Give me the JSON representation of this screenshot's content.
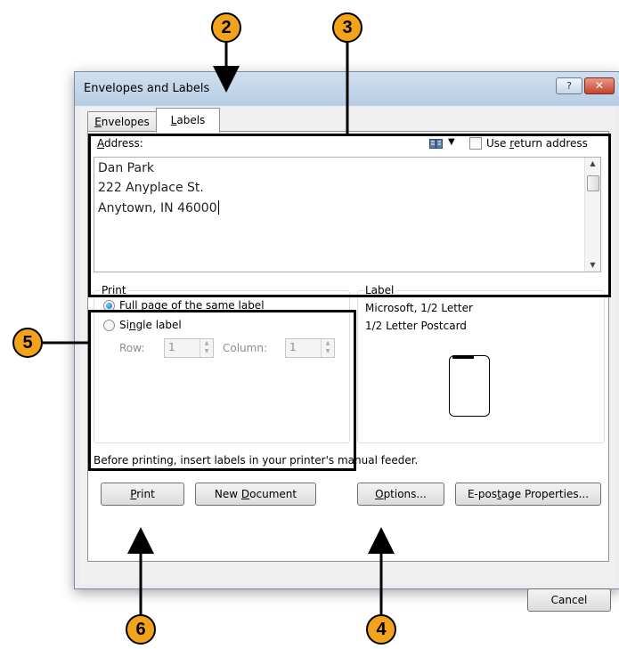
{
  "window": {
    "title": "Envelopes and Labels",
    "help_button": "?",
    "close_button": "✕"
  },
  "tabs": [
    {
      "label": "Envelopes",
      "mnemonic": "E",
      "rest": "nvelopes",
      "active": false
    },
    {
      "label": "Labels",
      "mnemonic": "L",
      "rest": "abels",
      "active": true
    }
  ],
  "address": {
    "label_mnemonic": "A",
    "label_rest": "ddress:",
    "lines": [
      "Dan Park",
      "222 Anyplace St.",
      "Anytown, IN 46000"
    ],
    "use_return": {
      "pre": "Use ",
      "mnemonic": "r",
      "post": "eturn address",
      "checked": false
    }
  },
  "print_group": {
    "title": "Print",
    "full_page": {
      "mnemonic": "F",
      "rest": "ull page of the same label",
      "selected": true
    },
    "single": {
      "pre": "Si",
      "mnemonic": "n",
      "post": "gle label",
      "selected": false
    },
    "row_label": "Row:",
    "row_value": "1",
    "column_label": "Column:",
    "column_value": "1"
  },
  "label_group": {
    "title": "Label",
    "vendor": "Microsoft, 1/2 Letter",
    "product": "1/2 Letter Postcard"
  },
  "note": "Before printing, insert labels in your printer's manual feeder.",
  "buttons": {
    "print": {
      "mnemonic": "P",
      "rest": "rint"
    },
    "new_document": {
      "pre": "New ",
      "mnemonic": "D",
      "post": "ocument"
    },
    "options": {
      "mnemonic": "O",
      "rest": "ptions..."
    },
    "epostage": {
      "pre": "E-pos",
      "mnemonic": "t",
      "post": "age Properties..."
    },
    "cancel": "Cancel"
  },
  "callouts": [
    "2",
    "3",
    "5",
    "6",
    "4"
  ],
  "colors": {
    "callout_fill": "#f2a21b",
    "title_bar": "#b7cde4",
    "close_red": "#c4452c"
  }
}
